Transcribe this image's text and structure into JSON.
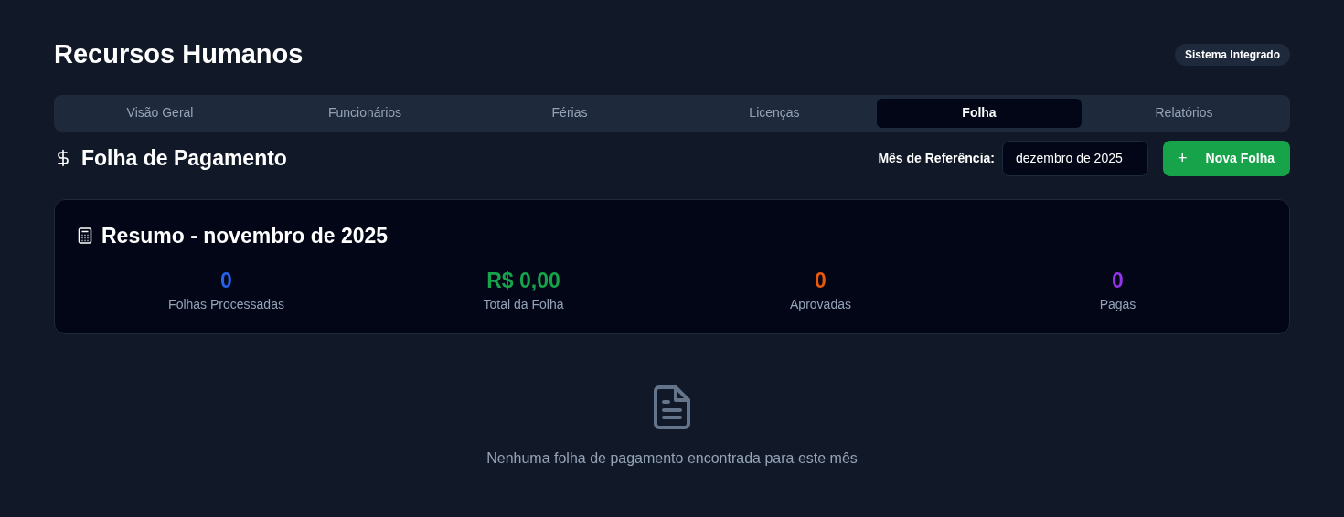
{
  "header": {
    "title": "Recursos Humanos",
    "badge": "Sistema Integrado"
  },
  "tabs": [
    {
      "label": "Visão Geral",
      "selected": false
    },
    {
      "label": "Funcionários",
      "selected": false
    },
    {
      "label": "Férias",
      "selected": false
    },
    {
      "label": "Licenças",
      "selected": false
    },
    {
      "label": "Folha",
      "selected": true
    },
    {
      "label": "Relatórios",
      "selected": false
    }
  ],
  "section": {
    "title": "Folha de Pagamento",
    "month_label": "Mês de Referência:",
    "month_value": "dezembro de 2025",
    "new_button": "Nova Folha",
    "plus": "+"
  },
  "summary": {
    "title": "Resumo - novembro de 2025",
    "stats": [
      {
        "value": "0",
        "label": "Folhas Processadas",
        "color": "#2563eb"
      },
      {
        "value": "R$ 0,00",
        "label": "Total da Folha",
        "color": "#16a34a"
      },
      {
        "value": "0",
        "label": "Aprovadas",
        "color": "#ea580c"
      },
      {
        "value": "0",
        "label": "Pagas",
        "color": "#9333ea"
      }
    ]
  },
  "empty_state": {
    "message": "Nenhuma folha de pagamento encontrada para este mês"
  }
}
